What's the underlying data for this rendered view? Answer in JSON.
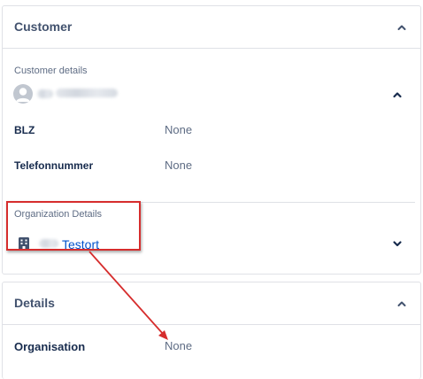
{
  "customer_panel": {
    "title": "Customer",
    "customer_details_label": "Customer details",
    "fields": [
      {
        "label": "BLZ",
        "value": "None"
      },
      {
        "label": "Telefonnummer",
        "value": "None"
      }
    ],
    "organization_details_label": "Organization Details",
    "organization_name": "Testort"
  },
  "details_panel": {
    "title": "Details",
    "fields": [
      {
        "label": "Organisation",
        "value": "None"
      }
    ]
  },
  "colors": {
    "annotation_red": "#d62d2d",
    "link_blue": "#0052cc",
    "text_dark": "#172b4d",
    "text_muted": "#5e6c84"
  },
  "icons": {
    "collapse": "chevron-up-icon",
    "expand": "chevron-down-icon",
    "customer_avatar": "user-avatar-icon",
    "organization": "building-icon"
  }
}
